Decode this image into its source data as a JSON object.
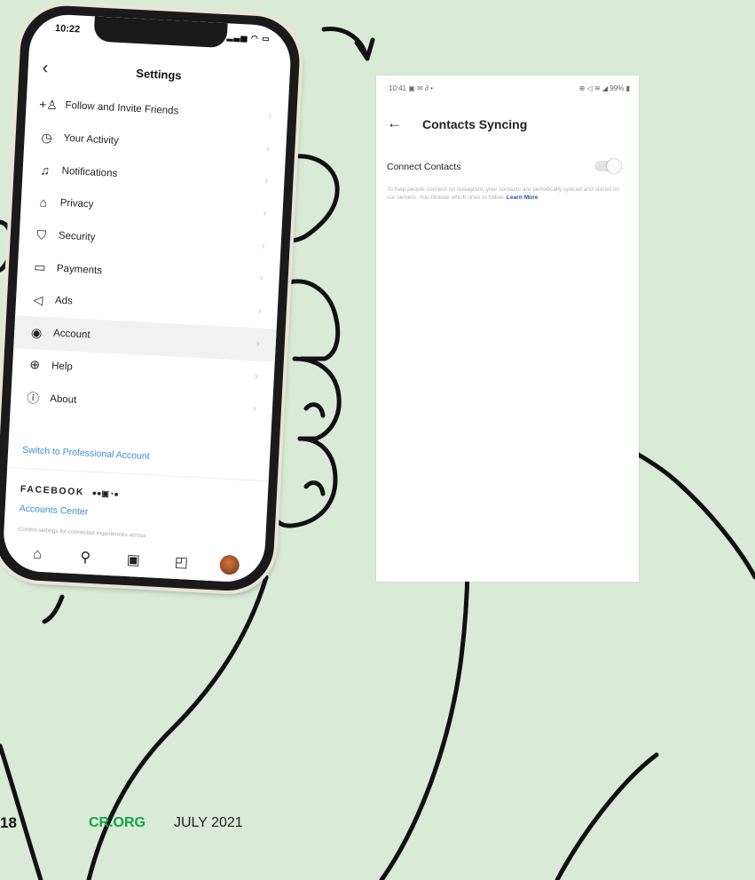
{
  "iphone": {
    "status_time": "10:22",
    "status_icons": "▂▃▅ ◠ ▭",
    "header_title": "Settings",
    "back_icon": "chevron-left-icon",
    "menu": [
      {
        "label": "Follow and Invite Friends",
        "icon": "add-person-icon",
        "glyph": "+♙"
      },
      {
        "label": "Your Activity",
        "icon": "activity-clock-icon",
        "glyph": "◷"
      },
      {
        "label": "Notifications",
        "icon": "bell-icon",
        "glyph": "♫"
      },
      {
        "label": "Privacy",
        "icon": "lock-icon",
        "glyph": "⌂"
      },
      {
        "label": "Security",
        "icon": "shield-icon",
        "glyph": "⛉"
      },
      {
        "label": "Payments",
        "icon": "card-icon",
        "glyph": "▭"
      },
      {
        "label": "Ads",
        "icon": "megaphone-icon",
        "glyph": "◁"
      },
      {
        "label": "Account",
        "icon": "account-icon",
        "glyph": "◉"
      },
      {
        "label": "Help",
        "icon": "lifebuoy-icon",
        "glyph": "⊕"
      },
      {
        "label": "About",
        "icon": "info-icon",
        "glyph": "ⓘ"
      }
    ],
    "selected_item": "Account",
    "switch_professional": "Switch to Professional Account",
    "facebook_label": "FACEBOOK",
    "facebook_icons": "●●▣◔●",
    "accounts_center": "Accounts Center",
    "fine_print": "Control settings for connected experiences across",
    "tabbar": [
      {
        "icon": "home-icon",
        "glyph": "⌂"
      },
      {
        "icon": "search-icon",
        "glyph": "⚲"
      },
      {
        "icon": "reels-icon",
        "glyph": "▣"
      },
      {
        "icon": "shop-bag-icon",
        "glyph": "◰"
      },
      {
        "icon": "profile-avatar-icon",
        "glyph": ""
      }
    ]
  },
  "android": {
    "status_left": "10:41 ▣ ✉ ∂ •",
    "status_right": "⊕ ◁ ≋ ◢ 99% ▮",
    "back_icon": "arrow-left-icon",
    "title": "Contacts Syncing",
    "connect_label": "Connect Contacts",
    "toggle_state": "off",
    "description": "To help people connect on Instagram, your contacts are periodically synced and stored on our servers. You choose which ones to follow.",
    "learn_more": "Learn More"
  },
  "footer": {
    "page_number": "18",
    "publication": "CR.ORG",
    "date": "JULY 2021"
  },
  "colors": {
    "background": "#d9ebd7",
    "link_blue": "#3a8fd8",
    "brand_green": "#15a244"
  }
}
